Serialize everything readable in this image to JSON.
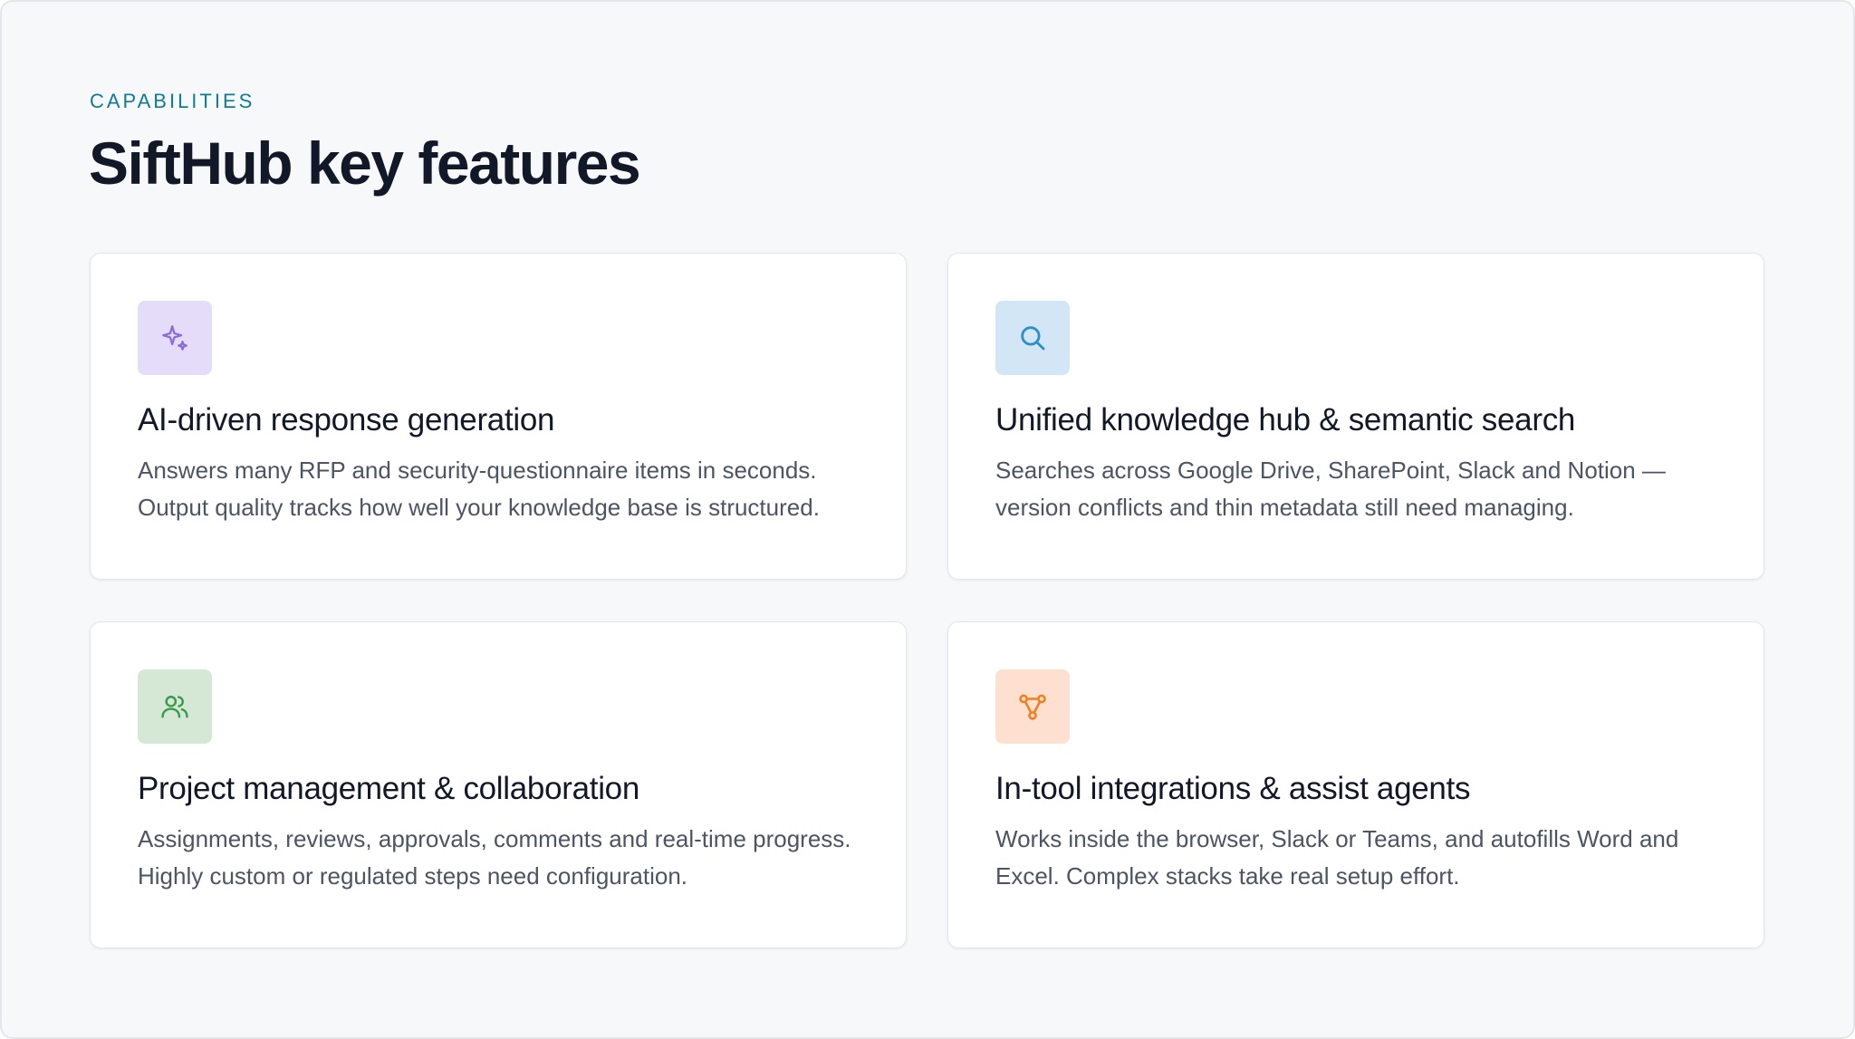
{
  "section": {
    "eyebrow": "CAPABILITIES",
    "title": "SiftHub key features"
  },
  "features": [
    {
      "icon": "sparkle-icon",
      "icon_bg": "#e5dcfa",
      "icon_color": "#8b6ae0",
      "title": "AI-driven response generation",
      "description": "Answers many RFP and security-questionnaire items in seconds. Output quality tracks how well your knowledge base is structured."
    },
    {
      "icon": "search-icon",
      "icon_bg": "#d3e6f5",
      "icon_color": "#2b8fc8",
      "title": "Unified knowledge hub & semantic search",
      "description": "Searches across Google Drive, SharePoint, Slack and Notion — version conflicts and thin metadata still need managing."
    },
    {
      "icon": "users-icon",
      "icon_bg": "#d5e8d6",
      "icon_color": "#3a9a4a",
      "title": "Project management & collaboration",
      "description": "Assignments, reviews, approvals, comments and real-time progress. Highly custom or regulated steps need configuration."
    },
    {
      "icon": "integration-icon",
      "icon_bg": "#fde0d0",
      "icon_color": "#f07f1f",
      "title": "In-tool integrations & assist agents",
      "description": "Works inside the browser, Slack or Teams, and autofills Word and Excel. Complex stacks take real setup effort."
    }
  ]
}
